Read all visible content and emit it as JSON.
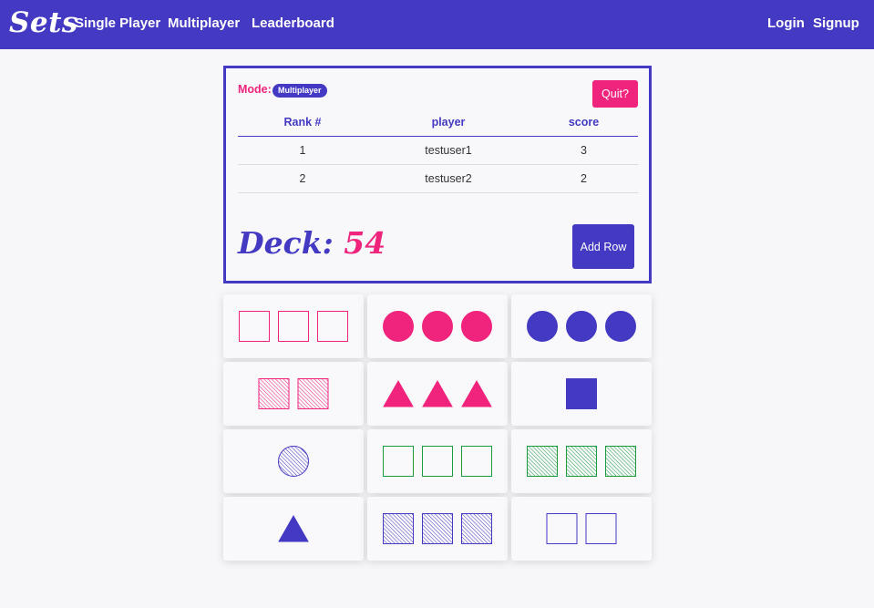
{
  "nav": {
    "brand": "Sets",
    "links": [
      "Single Player",
      "Multiplayer",
      "Leaderboard"
    ],
    "login": "Login",
    "signup": "Signup"
  },
  "game": {
    "mode_label": "Mode:",
    "mode": "Multiplayer",
    "quit_label": "Quit?",
    "columns": [
      "Rank #",
      "player",
      "score"
    ],
    "rows": [
      [
        "1",
        "testuser1",
        "3"
      ],
      [
        "2",
        "testuser2",
        "2"
      ]
    ],
    "deck_label": "Deck:",
    "deck_count": "54",
    "add_row_label": "Add Row"
  },
  "colors": {
    "primary": "#4339c2",
    "accent": "#f0237d",
    "green": "#1a9c3e"
  },
  "cards": [
    {
      "count": 3,
      "shape": "square",
      "color": "pink",
      "fill": "empty"
    },
    {
      "count": 3,
      "shape": "circle",
      "color": "pink",
      "fill": "solid"
    },
    {
      "count": 3,
      "shape": "circle",
      "color": "purple",
      "fill": "solid"
    },
    {
      "count": 2,
      "shape": "square",
      "color": "pink",
      "fill": "striped"
    },
    {
      "count": 3,
      "shape": "triangle",
      "color": "pink",
      "fill": "solid"
    },
    {
      "count": 1,
      "shape": "square",
      "color": "purple",
      "fill": "solid"
    },
    {
      "count": 1,
      "shape": "circle",
      "color": "purple",
      "fill": "striped"
    },
    {
      "count": 3,
      "shape": "square",
      "color": "green",
      "fill": "empty"
    },
    {
      "count": 3,
      "shape": "square",
      "color": "green",
      "fill": "striped"
    },
    {
      "count": 1,
      "shape": "triangle",
      "color": "purple",
      "fill": "solid"
    },
    {
      "count": 3,
      "shape": "square",
      "color": "purple",
      "fill": "striped"
    },
    {
      "count": 2,
      "shape": "square",
      "color": "purple",
      "fill": "empty"
    }
  ]
}
